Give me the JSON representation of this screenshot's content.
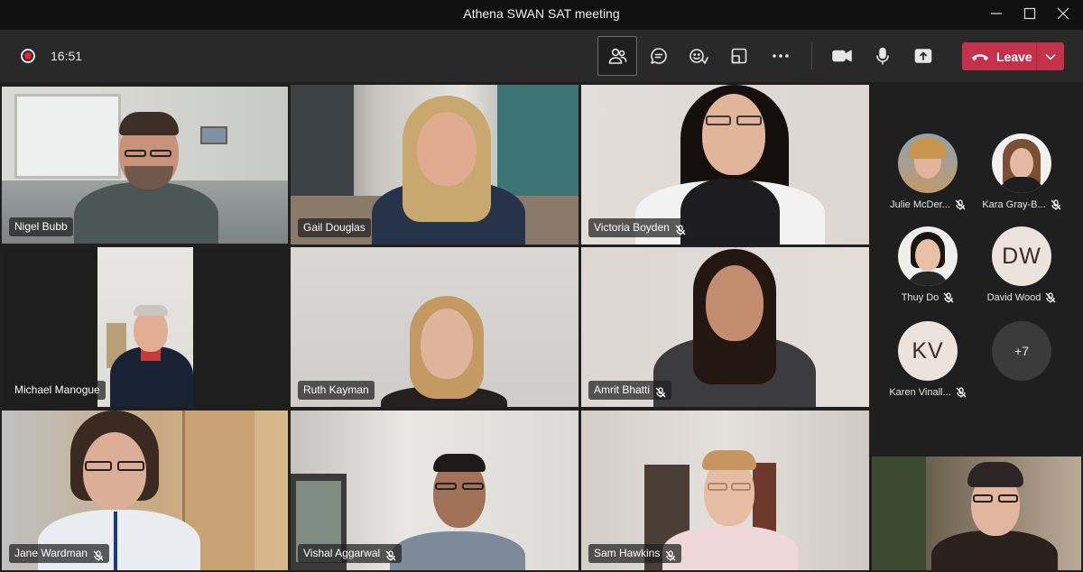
{
  "window": {
    "title": "Athena SWAN SAT meeting"
  },
  "meeting": {
    "timer": "16:51",
    "leave_label": "Leave"
  },
  "controls": [
    {
      "icon": "people-icon",
      "label": "Participants"
    },
    {
      "icon": "chat-icon",
      "label": "Chat"
    },
    {
      "icon": "reactions-icon",
      "label": "React"
    },
    {
      "icon": "rooms-icon",
      "label": "Rooms"
    },
    {
      "icon": "more-icon",
      "label": "More actions"
    },
    {
      "icon": "camera-icon",
      "label": "Camera"
    },
    {
      "icon": "mic-icon",
      "label": "Mic"
    },
    {
      "icon": "share-icon",
      "label": "Share"
    }
  ],
  "tiles": [
    {
      "name": "Nigel Bubb",
      "muted": false
    },
    {
      "name": "Gail Douglas",
      "muted": false
    },
    {
      "name": "Victoria Boyden",
      "muted": true
    },
    {
      "name": "Michael Manogue",
      "muted": false
    },
    {
      "name": "Ruth Kayman",
      "muted": false
    },
    {
      "name": "Amrit Bhatti",
      "muted": true
    },
    {
      "name": "Jane Wardman",
      "muted": true
    },
    {
      "name": "Vishal Aggarwal",
      "muted": true
    },
    {
      "name": "Sam Hawkins",
      "muted": true
    }
  ],
  "roster": [
    {
      "name": "Julie McDer...",
      "initials": "",
      "muted": true
    },
    {
      "name": "Kara Gray-B...",
      "initials": "",
      "muted": true
    },
    {
      "name": "Thuy Do",
      "initials": "",
      "muted": true
    },
    {
      "name": "David Wood",
      "initials": "DW",
      "muted": true
    },
    {
      "name": "Karen Vinall...",
      "initials": "KV",
      "muted": true
    },
    {
      "name": "",
      "initials": "+7",
      "muted": false
    }
  ],
  "colors": {
    "leave": "#c4314b",
    "active_speaker": "#8b8cc7",
    "background": "#1f1f1f"
  }
}
